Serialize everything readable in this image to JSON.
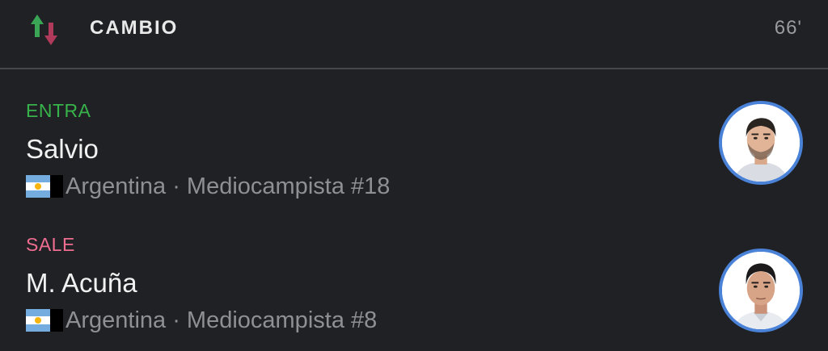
{
  "header": {
    "title": "CAMBIO",
    "minute": "66'",
    "icon": "substitution-arrows-icon",
    "colors": {
      "up_arrow": "#3aa655",
      "down_arrow": "#b03a5b"
    }
  },
  "player_in": {
    "role": "ENTRA",
    "name": "Salvio",
    "country": "Argentina",
    "separator": "·",
    "position": "Mediocampista #18",
    "meta": "Argentina · Mediocampista #18",
    "flag": "argentina-flag-icon",
    "role_color": "#38b24a"
  },
  "player_out": {
    "role": "SALE",
    "name": "M. Acuña",
    "country": "Argentina",
    "separator": "·",
    "position": "Mediocampista #8",
    "meta": "Argentina · Mediocampista #8",
    "flag": "argentina-flag-icon",
    "role_color": "#ee6d90"
  },
  "colors": {
    "background": "#202124",
    "avatar_ring": "#4a82d8",
    "divider": "#45474b"
  }
}
